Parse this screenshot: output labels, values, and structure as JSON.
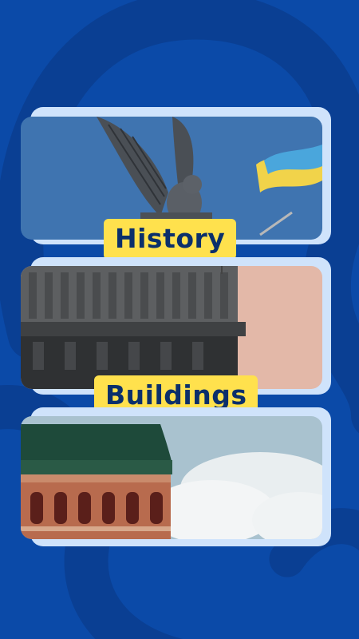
{
  "labels": {
    "first": "History",
    "second": "Buildings"
  },
  "colors": {
    "background": "#0b4aa8",
    "swirl": "#0a3f93",
    "card_border": "#cfe3fb",
    "label_bg": "#ffe14d",
    "label_text": "#0b2f6b"
  },
  "images": [
    {
      "name": "angel-statue-with-ukrainian-flag"
    },
    {
      "name": "brutalist-building-roof"
    },
    {
      "name": "ornate-building-with-green-dome"
    }
  ]
}
